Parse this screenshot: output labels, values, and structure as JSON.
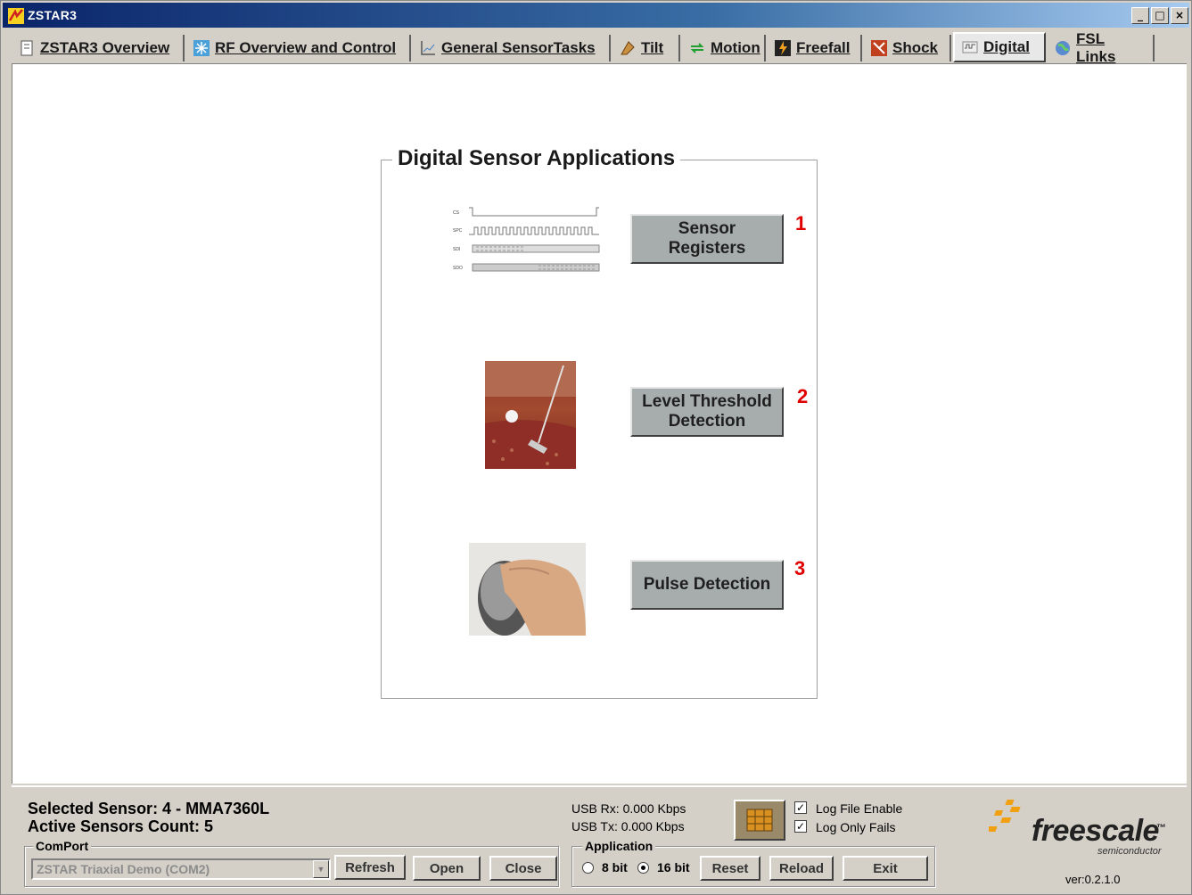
{
  "window": {
    "title": "ZSTAR3",
    "min_label": "_",
    "max_label": "□",
    "close_label": "×"
  },
  "tabs": [
    {
      "label": "ZSTAR3 Overview",
      "icon": "document-icon"
    },
    {
      "label": "RF Overview and Control",
      "icon": "network-icon"
    },
    {
      "label": "General SensorTasks",
      "icon": "chart-icon"
    },
    {
      "label": "Tilt",
      "icon": "tilt-icon"
    },
    {
      "label": "Motion",
      "icon": "motion-icon"
    },
    {
      "label": "Freefall",
      "icon": "freefall-icon"
    },
    {
      "label": "Shock",
      "icon": "shock-icon"
    },
    {
      "label": "Digital",
      "icon": "digital-icon",
      "active": true
    },
    {
      "label": "FSL Links",
      "icon": "globe-icon"
    }
  ],
  "main": {
    "group_title": "Digital Sensor Applications",
    "apps": [
      {
        "label": "Sensor\nRegisters",
        "number": "1",
        "image": "spi-timing-diagram"
      },
      {
        "label": "Level Threshold\nDetection",
        "number": "2",
        "image": "golf-putt-photo"
      },
      {
        "label": "Pulse Detection",
        "number": "3",
        "image": "computer-mouse-photo"
      }
    ],
    "timing_signals": [
      "CS",
      "SPC",
      "SDI",
      "SDO"
    ]
  },
  "status": {
    "selected_sensor": "Selected Sensor: 4 - MMA7360L",
    "active_count": "Active Sensors Count: 5",
    "comport_legend": "ComPort",
    "comport_value": "ZSTAR Triaxial Demo (COM2)",
    "refresh": "Refresh",
    "open": "Open",
    "close": "Close",
    "usb_rx": "USB Rx:  0.000 Kbps",
    "usb_tx": "USB Tx:  0.000 Kbps",
    "application_legend": "Application",
    "bit8": "8 bit",
    "bit16": "16 bit",
    "bit16_selected": true,
    "reset": "Reset",
    "reload": "Reload",
    "exit": "Exit",
    "log_file_enable": "Log File Enable",
    "log_only_fails": "Log Only Fails",
    "log_file_checked": true,
    "log_fails_checked": true,
    "brand": "freescale",
    "brand_sub": "semiconductor",
    "brand_tm": "™",
    "version": "ver:0.2.1.0"
  },
  "colors": {
    "accent_red": "#e00000",
    "app_button": "#a7adad",
    "title_bar": "#0a246a"
  }
}
